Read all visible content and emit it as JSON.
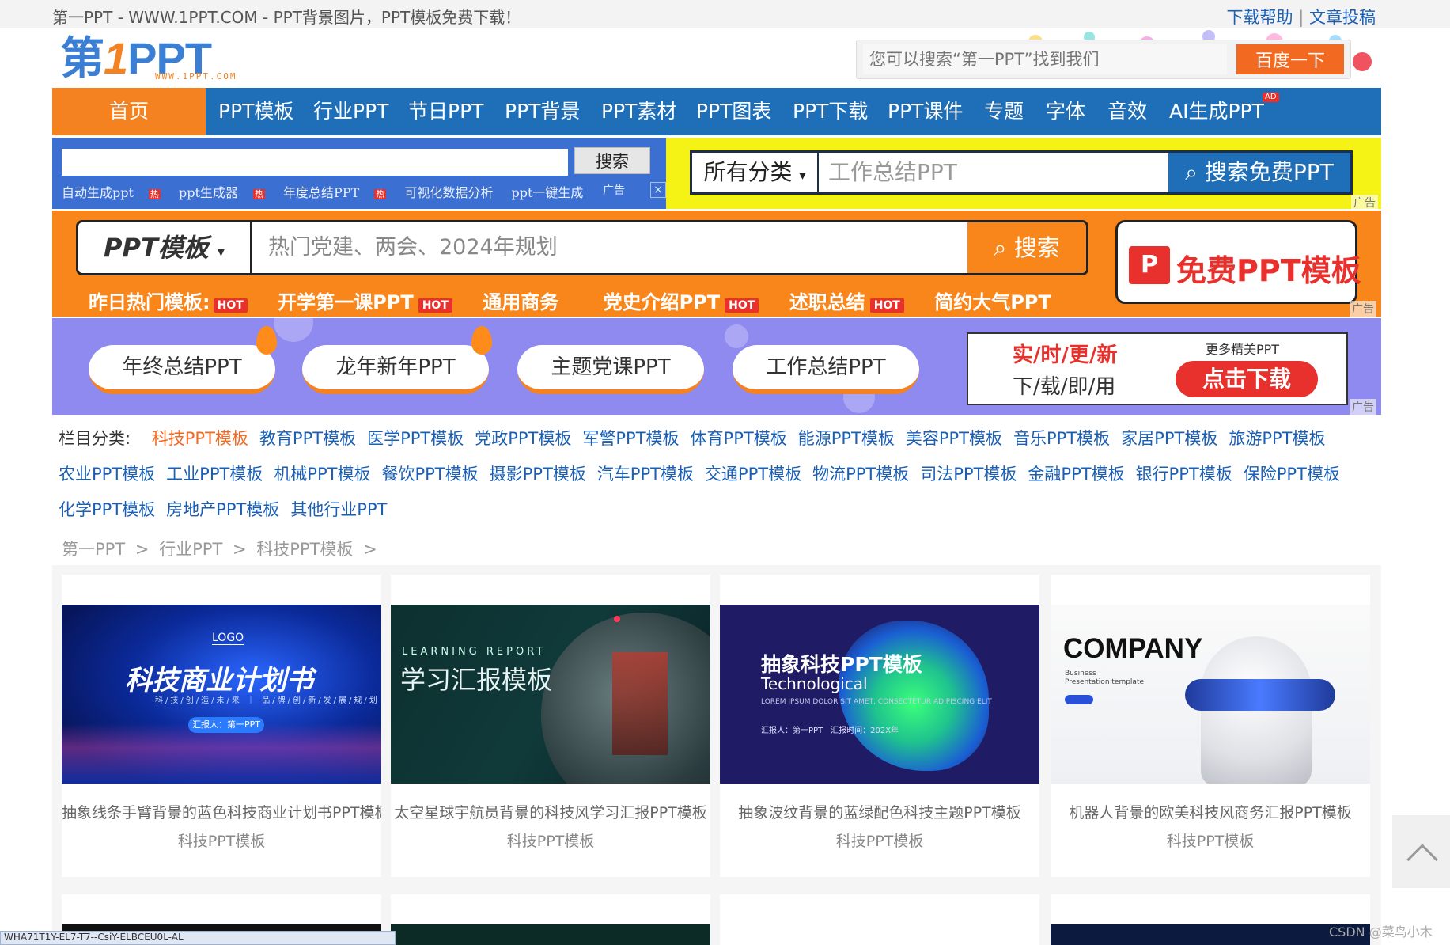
{
  "topbar": {
    "slogan": "第一PPT - WWW.1PPT.COM - PPT背景图片，PPT模板免费下载！",
    "links": [
      "下载帮助",
      "文章投稿"
    ],
    "separator": "|"
  },
  "logo": {
    "prefix": "第",
    "one": "1",
    "main": "PPT",
    "domain": "WWW.1PPT.COM"
  },
  "header_search": {
    "placeholder": "您可以搜索“第一PPT”找到我们",
    "button": "百度一下"
  },
  "nav": {
    "items": [
      {
        "label": "首页",
        "active": true
      },
      {
        "label": "PPT模板"
      },
      {
        "label": "行业PPT"
      },
      {
        "label": "节日PPT"
      },
      {
        "label": "PPT背景"
      },
      {
        "label": "PPT素材"
      },
      {
        "label": "PPT图表"
      },
      {
        "label": "PPT下载"
      },
      {
        "label": "PPT课件"
      },
      {
        "label": "专题"
      },
      {
        "label": "字体"
      },
      {
        "label": "音效"
      },
      {
        "label": "AI生成PPT",
        "badge": "AD"
      }
    ]
  },
  "ad_blue": {
    "button": "搜索",
    "links": [
      "自动生成ppt",
      "ppt生成器",
      "年度总结PPT",
      "可视化数据分析",
      "ppt一键生成"
    ],
    "hot_mark": "热",
    "ad_label": "广告",
    "close": "×"
  },
  "ad_yellow": {
    "category": "所有分类",
    "placeholder": "工作总结PPT",
    "button": "搜索免费PPT",
    "ad_label": "广告"
  },
  "ad_orange": {
    "category": "PPT模板",
    "placeholder": "热门党建、两会、2024年规划",
    "button": "搜索",
    "tags_label": "昨日热门模板:",
    "tags": [
      {
        "label": "开学第一课PPT",
        "hot": true
      },
      {
        "label": "通用商务",
        "hot": false
      },
      {
        "label": "党史介绍PPT",
        "hot": true
      },
      {
        "label": "述职总结",
        "hot": true
      },
      {
        "label": "简约大气PPT",
        "hot": false
      }
    ],
    "hot_text": "HOT",
    "free_icon": "P",
    "free_text": "免费PPT模板",
    "ad_label": "广告"
  },
  "ad_purple": {
    "pills": [
      "年终总结PPT",
      "龙年新年PPT",
      "主题党课PPT",
      "工作总结PPT"
    ],
    "line1": "实/时/更/新",
    "line2": "下/载/即/用",
    "more": "更多精美PPT",
    "download": "点击下载",
    "ad_label": "广告"
  },
  "categories": {
    "label": "栏目分类:",
    "items": [
      "科技PPT模板",
      "教育PPT模板",
      "医学PPT模板",
      "党政PPT模板",
      "军警PPT模板",
      "体育PPT模板",
      "能源PPT模板",
      "美容PPT模板",
      "音乐PPT模板",
      "家居PPT模板",
      "旅游PPT模板",
      "农业PPT模板",
      "工业PPT模板",
      "机械PPT模板",
      "餐饮PPT模板",
      "摄影PPT模板",
      "汽车PPT模板",
      "交通PPT模板",
      "物流PPT模板",
      "司法PPT模板",
      "金融PPT模板",
      "银行PPT模板",
      "保险PPT模板",
      "化学PPT模板",
      "房地产PPT模板",
      "其他行业PPT"
    ],
    "active_index": 0
  },
  "breadcrumb": [
    "第一PPT",
    "行业PPT",
    "科技PPT模板"
  ],
  "breadcrumb_sep": ">",
  "cards": [
    {
      "title": "抽象线条手臂背景的蓝色科技商业计划书PPT模板",
      "category": "科技PPT模板",
      "thumb": {
        "logo": "LOGO",
        "headline": "科技商业计划书",
        "sub": "科/技/创/造/未/来 ｜ 品/牌/创/新/发/展/规/划",
        "pill": "汇报人：第一PPT"
      }
    },
    {
      "title": "太空星球宇航员背景的科技风学习汇报PPT模板",
      "category": "科技PPT模板",
      "thumb": {
        "en": "LEARNING REPORT",
        "headline": "学习汇报模板"
      }
    },
    {
      "title": "抽象波纹背景的蓝绿配色科技主题PPT模板",
      "category": "科技PPT模板",
      "thumb": {
        "headline": "抽象科技PPT模板",
        "en": "Technological",
        "sm": "LOREM IPSUM DOLOR SIT AMET, CONSECTETUR ADIPISCING ELIT",
        "sm2": "汇报人：第一PPT　汇报时间：202X年"
      }
    },
    {
      "title": "机器人背景的欧美科技风商务汇报PPT模板",
      "category": "科技PPT模板",
      "thumb": {
        "headline": "COMPANY",
        "sm": "Business\nPresentation template"
      }
    }
  ],
  "watermark": "CSDN @菜鸟小木",
  "status_bar": "WHA71T1Y-EL7-T7--CsiY-ELBCEU0L-AL"
}
